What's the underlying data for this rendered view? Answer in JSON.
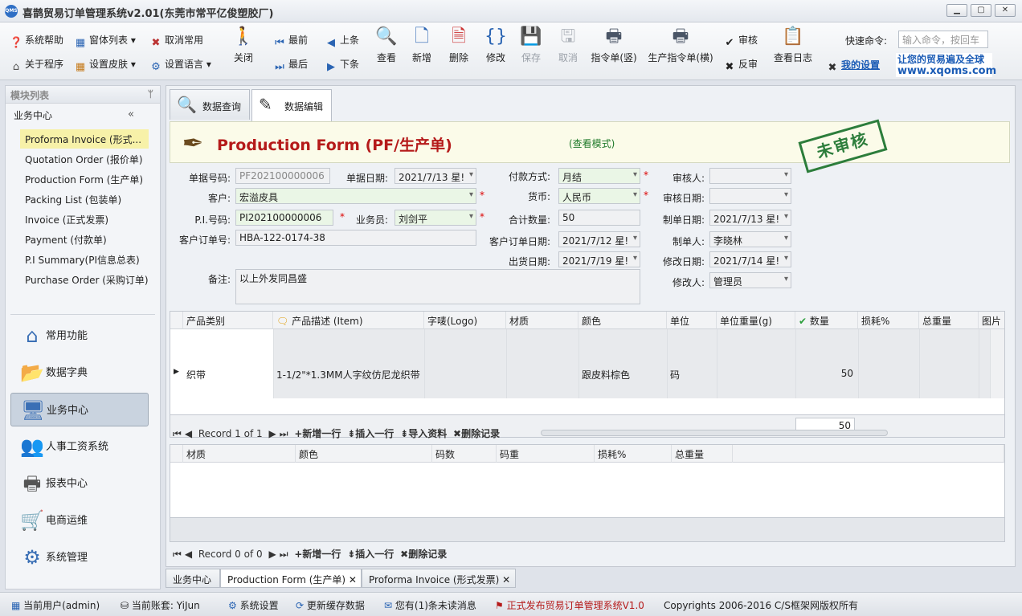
{
  "app": {
    "title": "喜鹊贸易订单管理系统v2.01(东莞市常平亿俊塑胶厂)",
    "logo_text": "QMS"
  },
  "toolbar": {
    "small": [
      {
        "label": "系统帮助",
        "icon": "help-icon"
      },
      {
        "label": "窗体列表",
        "icon": "window-list-icon"
      },
      {
        "label": "取消常用",
        "icon": "cancel-icon"
      },
      {
        "label": "关于程序",
        "icon": "home-icon"
      },
      {
        "label": "设置皮肤",
        "icon": "skin-icon"
      },
      {
        "label": "设置语言",
        "icon": "language-icon"
      }
    ],
    "close_label": "关闭",
    "nav": {
      "first": "最前",
      "prev": "上条",
      "last": "最后",
      "next": "下条"
    },
    "buttons": {
      "view": "查看",
      "add": "新增",
      "delete": "删除",
      "edit": "修改",
      "save": "保存",
      "cancel": "取消",
      "print_v": "指令单(竖)",
      "print_h": "生产指令单(横)",
      "audit": "审核",
      "unaudit": "反审",
      "log": "查看日志"
    },
    "quick_label": "快速命令:",
    "quick_placeholder": "输入命令，按回车",
    "my_settings": "我的设置",
    "promo_line1": "让您的贸易遍及全球",
    "promo_line2": "www.xqoms.com"
  },
  "sidebar": {
    "header": "模块列表",
    "group": "业务中心",
    "items": [
      "Proforma Invoice (形式...",
      "Quotation Order (报价单)",
      "Production Form (生产单)",
      "Packing List (包装单)",
      "Invoice (正式发票)",
      "Payment (付款单)",
      "P.I Summary(PI信息总表)",
      "Purchase Order (采购订单)"
    ],
    "modules": [
      "常用功能",
      "数据字典",
      "业务中心",
      "人事工资系统",
      "报表中心",
      "电商运维",
      "系统管理"
    ]
  },
  "tabs": {
    "query": "数据查询",
    "edit": "数据编辑"
  },
  "form": {
    "title": "Production Form (PF/生产单)",
    "mode": "(查看模式)",
    "stamp": "未审核",
    "labels": {
      "doc_no": "单据号码:",
      "doc_date": "单据日期:",
      "pay_method": "付款方式:",
      "auditor": "审核人:",
      "customer": "客户:",
      "currency": "货币:",
      "audit_date": "审核日期:",
      "pi_no": "P.I.号码:",
      "salesman": "业务员:",
      "total_qty": "合计数量:",
      "create_date": "制单日期:",
      "cust_order_no": "客户订单号:",
      "cust_order_date": "客户订单日期:",
      "creator": "制单人:",
      "ship_date": "出货日期:",
      "modify_date": "修改日期:",
      "remark": "备注:",
      "modifier": "修改人:"
    },
    "values": {
      "doc_no": "PF202100000006",
      "doc_date": "2021/7/13 星!",
      "pay_method": "月结",
      "auditor": "",
      "customer": "宏溢皮具",
      "currency": "人民币",
      "audit_date": "",
      "pi_no": "PI202100000006",
      "salesman": "刘剑平",
      "total_qty": "50",
      "create_date": "2021/7/13 星!",
      "cust_order_no": "HBA-122-0174-38",
      "cust_order_date": "2021/7/12 星!",
      "creator": "李晓林",
      "ship_date": "2021/7/19 星!",
      "modify_date": "2021/7/14 星!",
      "remark": "以上外发同昌盛",
      "modifier": "管理员"
    }
  },
  "grid1": {
    "columns": [
      "产品类别",
      "产品描述 (Item)",
      "字唛(Logo)",
      "材质",
      "颜色",
      "单位",
      "单位重量(g)",
      "数量",
      "损耗%",
      "总重量",
      "图片"
    ],
    "rows": [
      [
        "织带",
        "1-1/2\"*1.3MM人字纹仿尼龙织带",
        "",
        "",
        "跟皮料棕色",
        "码",
        "",
        "50",
        "",
        "",
        ""
      ]
    ],
    "total_qty": "50",
    "nav": {
      "record": "Record 1 of 1",
      "add_row": "新增一行",
      "insert_row": "插入一行",
      "import": "导入资料",
      "delete": "删除记录"
    }
  },
  "grid2": {
    "columns": [
      "材质",
      "颜色",
      "码数",
      "码重",
      "损耗%",
      "总重量"
    ],
    "nav": {
      "record": "Record 0 of 0",
      "add_row": "新增一行",
      "insert_row": "插入一行",
      "delete": "删除记录"
    }
  },
  "bottom_tabs": [
    "业务中心",
    "Production Form (生产单)",
    "Proforma Invoice (形式发票)"
  ],
  "status": {
    "user": "当前用户(admin)",
    "account": "当前账套: YiJun",
    "settings": "系统设置",
    "refresh": "更新缓存数据",
    "messages": "您有(1)条未读消息",
    "release": "正式发布贸易订单管理系统V1.0",
    "copyright": "Copyrights 2006-2016 C/S框架网版权所有"
  },
  "colors": {
    "accent_red": "#b51a1a",
    "stamp_green": "#2c7d3b",
    "selected_nav": "#f7f1a8",
    "link_blue": "#1a5bb5"
  }
}
